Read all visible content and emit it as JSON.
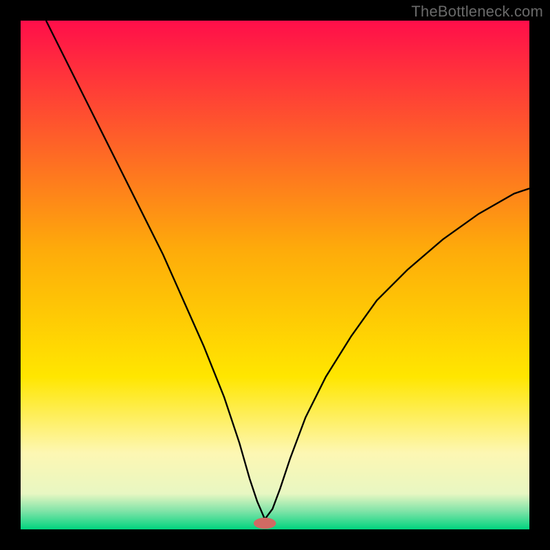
{
  "watermark": {
    "text": "TheBottleneck.com"
  },
  "chart_data": {
    "type": "line",
    "title": "",
    "xlabel": "",
    "ylabel": "",
    "xlim": [
      0,
      100
    ],
    "ylim": [
      0,
      100
    ],
    "grid": false,
    "legend": false,
    "background_gradient": {
      "stops": [
        {
          "offset": 0.0,
          "color": "#ff0e4a"
        },
        {
          "offset": 0.45,
          "color": "#feab0a"
        },
        {
          "offset": 0.7,
          "color": "#ffe600"
        },
        {
          "offset": 0.85,
          "color": "#fdf7b3"
        },
        {
          "offset": 0.93,
          "color": "#e8f7c2"
        },
        {
          "offset": 0.965,
          "color": "#7de3a7"
        },
        {
          "offset": 1.0,
          "color": "#00d47e"
        }
      ]
    },
    "marker": {
      "x": 48,
      "y": 1.2,
      "color": "#d16a63",
      "rx": 2.2,
      "ry": 1.1
    },
    "series": [
      {
        "name": "curve",
        "color": "#000000",
        "x": [
          5,
          8,
          12,
          16,
          20,
          24,
          28,
          32,
          36,
          40,
          43,
          45,
          46.5,
          48,
          49.5,
          51,
          53,
          56,
          60,
          65,
          70,
          76,
          83,
          90,
          97,
          100
        ],
        "values": [
          100,
          94,
          86,
          78,
          70,
          62,
          54,
          45,
          36,
          26,
          17,
          10,
          5.5,
          2,
          4,
          8,
          14,
          22,
          30,
          38,
          45,
          51,
          57,
          62,
          66,
          67
        ]
      }
    ]
  }
}
